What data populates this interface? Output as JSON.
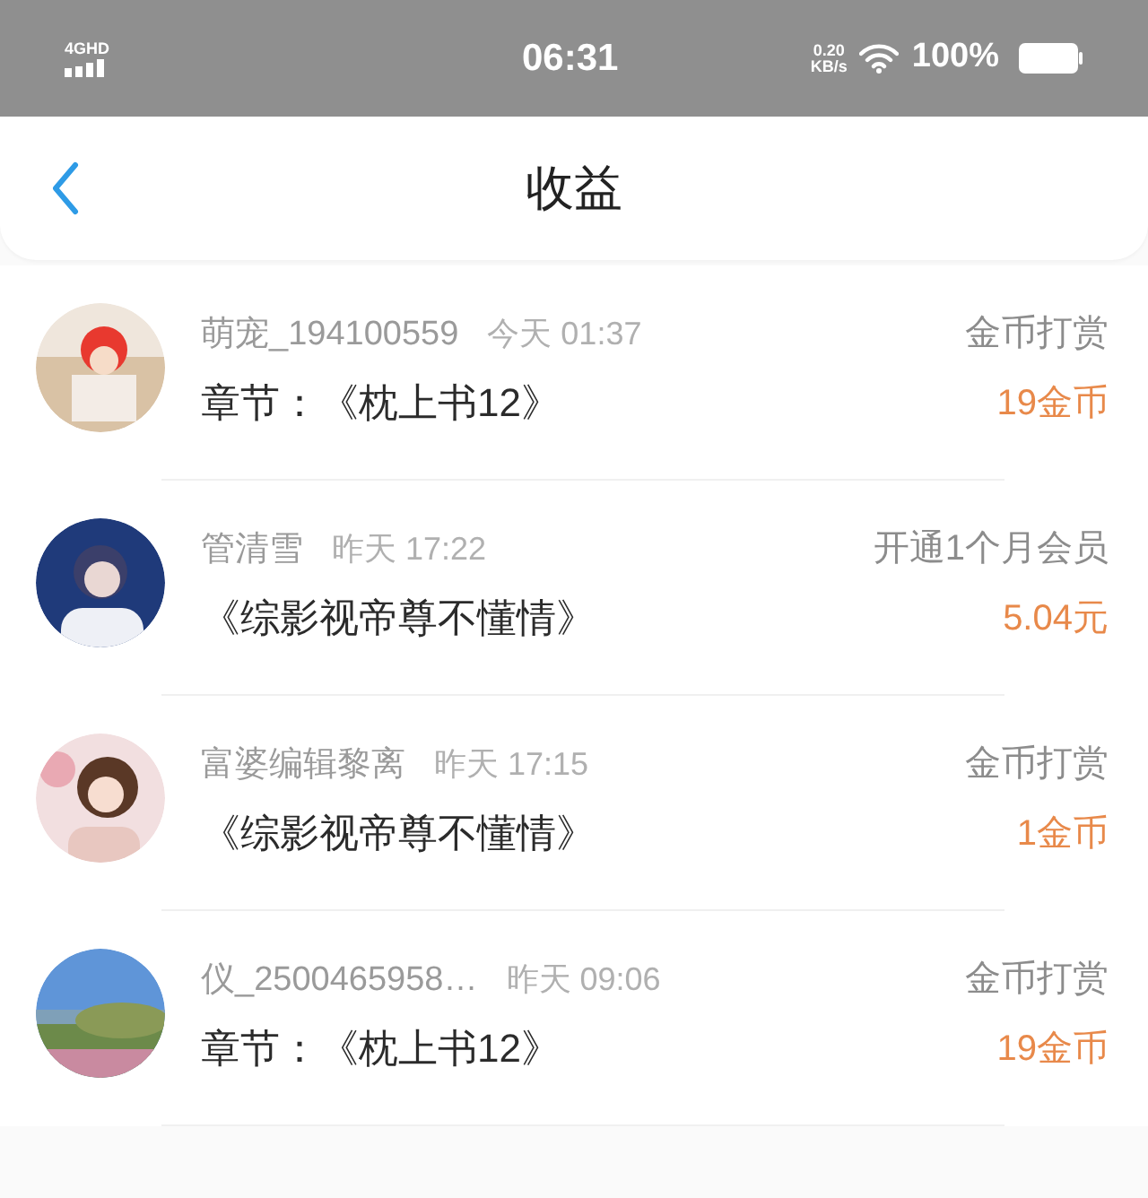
{
  "status_bar": {
    "network": "4GHD",
    "time": "06:31",
    "speed_value": "0.20",
    "speed_unit": "KB/s",
    "battery": "100%"
  },
  "header": {
    "title": "收益"
  },
  "items": [
    {
      "name": "萌宠_194100559",
      "time": "今天 01:37",
      "title": "章节：《枕上书12》",
      "type": "金币打赏",
      "amount": "19金币"
    },
    {
      "name": "管清雪",
      "time": "昨天 17:22",
      "title": "《综影视帝尊不懂情》",
      "type": "开通1个月会员",
      "amount": "5.04元"
    },
    {
      "name": "富婆编辑黎离",
      "time": "昨天 17:15",
      "title": "《综影视帝尊不懂情》",
      "type": "金币打赏",
      "amount": "1金币"
    },
    {
      "name": "仪_2500465958…",
      "time": "昨天 09:06",
      "title": "章节：《枕上书12》",
      "type": "金币打赏",
      "amount": "19金币"
    }
  ]
}
